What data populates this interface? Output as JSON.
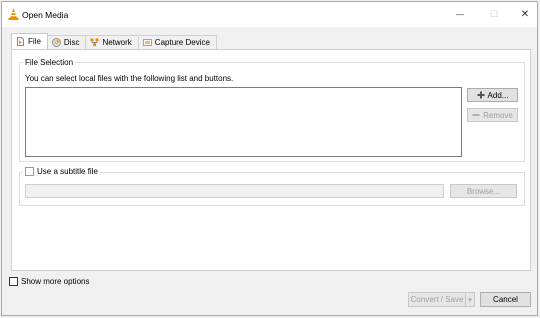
{
  "window": {
    "title": "Open Media",
    "minimize_glyph": "—",
    "maximize_glyph": "☐",
    "close_glyph": "✕",
    "app_icon": "vlc-cone-icon"
  },
  "tabs": [
    {
      "label": "File",
      "icon": "file-icon",
      "active": true
    },
    {
      "label": "Disc",
      "icon": "disc-icon",
      "active": false
    },
    {
      "label": "Network",
      "icon": "network-icon",
      "active": false
    },
    {
      "label": "Capture Device",
      "icon": "capture-device-icon",
      "active": false
    }
  ],
  "file_selection": {
    "group_title": "File Selection",
    "description": "You can select local files with the following list and buttons.",
    "add_label": "Add...",
    "remove_label": "Remove"
  },
  "subtitle": {
    "checkbox_label": "Use a subtitle file",
    "checked": false,
    "browse_label": "Browse..."
  },
  "footer": {
    "show_more_label": "Show more options",
    "show_more_checked": false,
    "convert_save_label": "Convert / Save",
    "dropdown_glyph": "▾",
    "cancel_label": "Cancel"
  },
  "colors": {
    "accent_orange": "#f08a00",
    "disabled_text": "#a0a0a0",
    "button_bg": "#e1e1e1"
  }
}
